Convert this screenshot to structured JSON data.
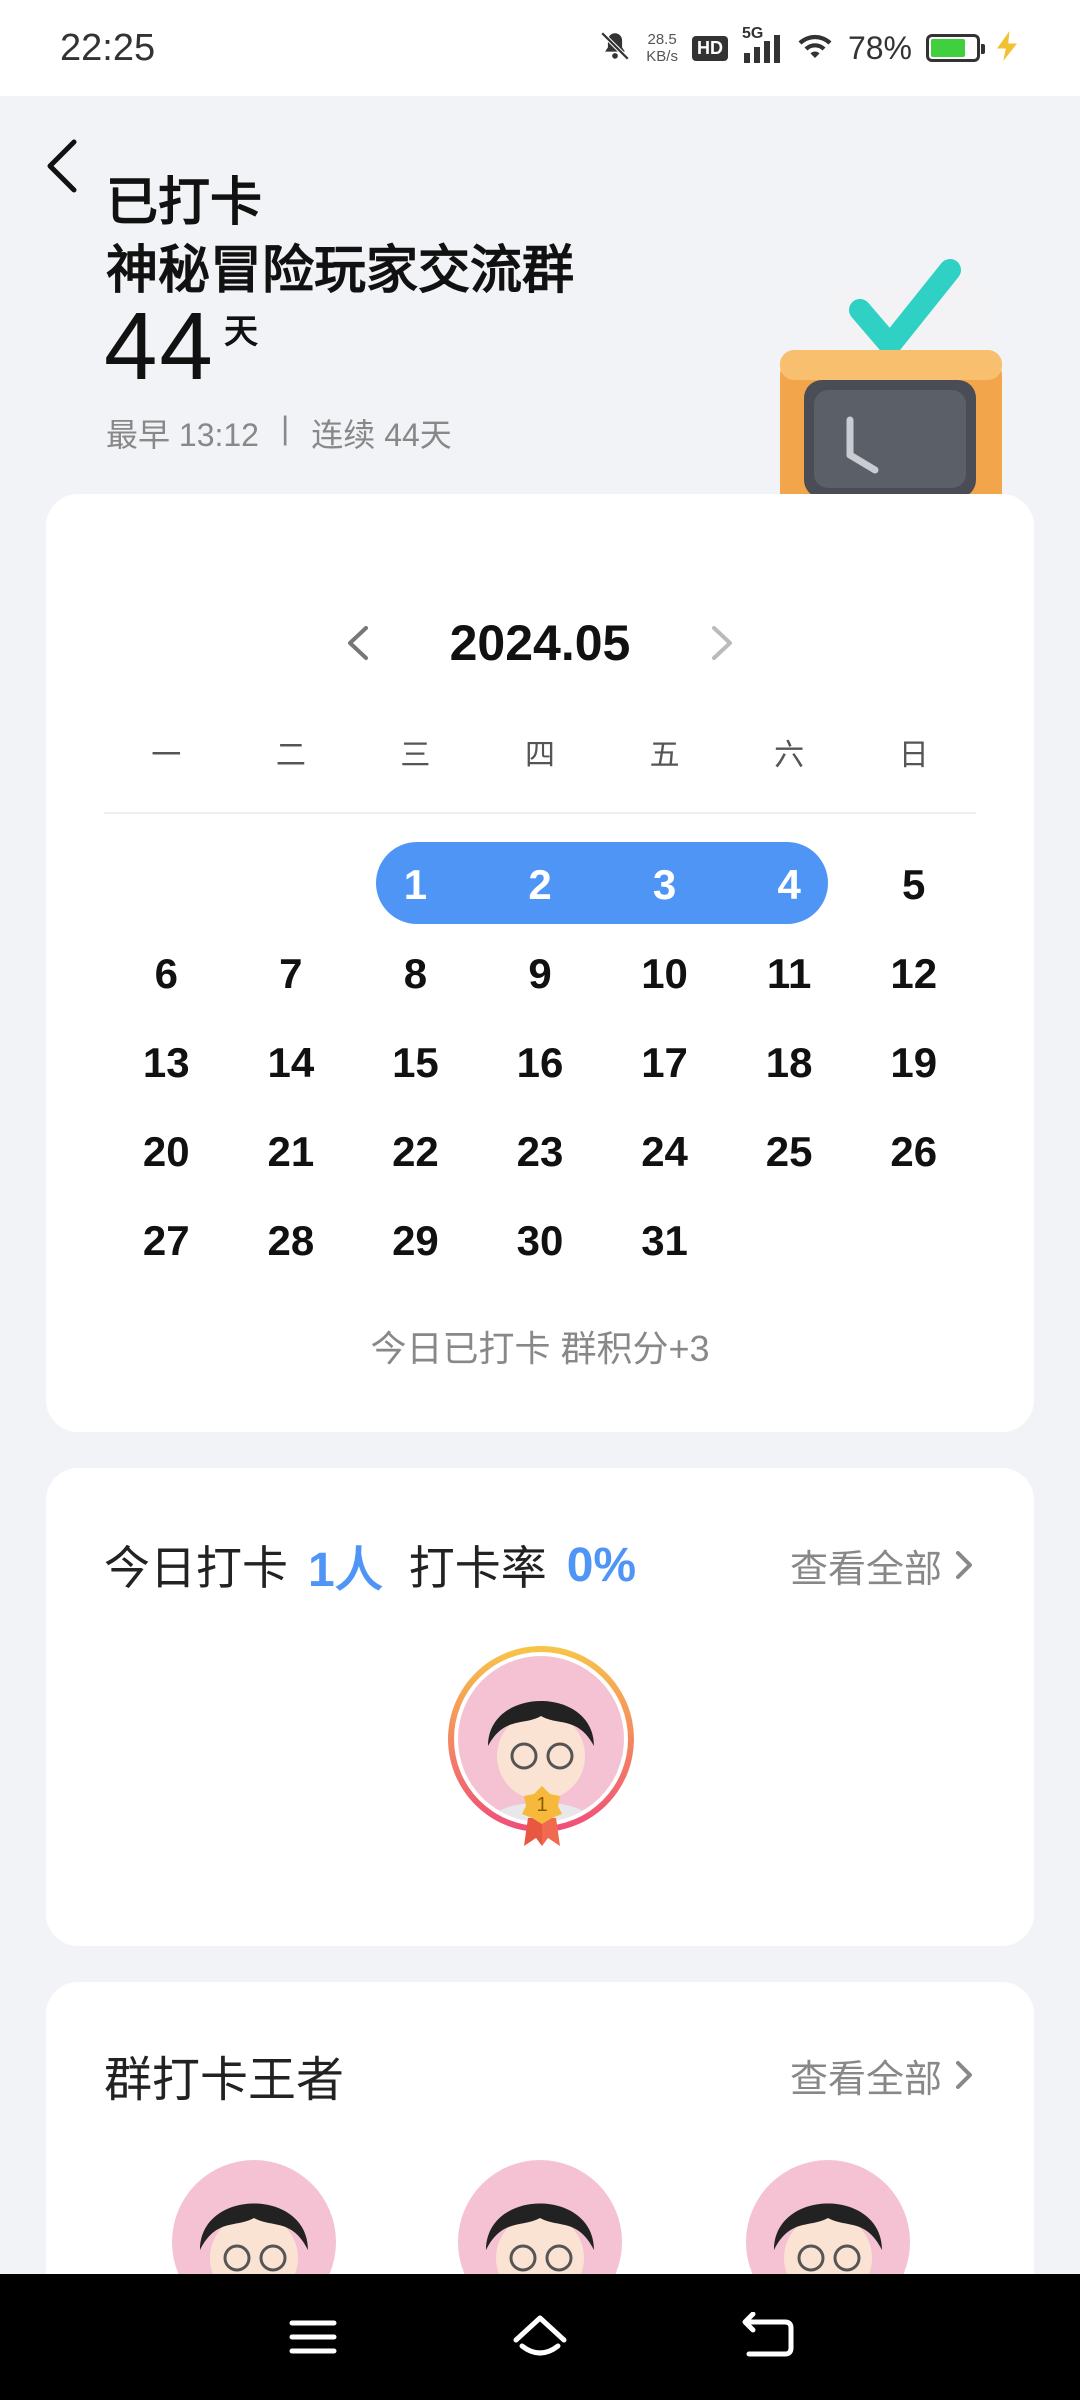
{
  "status_bar": {
    "time": "22:25",
    "speed_value": "28.5",
    "speed_unit": "KB/s",
    "hd": "HD",
    "network": "5G",
    "battery": "78%",
    "battery_level": 0.78
  },
  "header": {
    "status": "已打卡",
    "group_name": "神秘冒险玩家交流群",
    "days": "44",
    "days_unit": "天",
    "earliest": "最早 13:12",
    "separator": "|",
    "streak": "连续 44天"
  },
  "calendar": {
    "month": "2024.05",
    "weekdays": [
      "一",
      "二",
      "三",
      "四",
      "五",
      "六",
      "日"
    ],
    "leading_blanks": 2,
    "days": [
      "1",
      "2",
      "3",
      "4",
      "5",
      "6",
      "7",
      "8",
      "9",
      "10",
      "11",
      "12",
      "13",
      "14",
      "15",
      "16",
      "17",
      "18",
      "19",
      "20",
      "21",
      "22",
      "23",
      "24",
      "25",
      "26",
      "27",
      "28",
      "29",
      "30",
      "31"
    ],
    "checked_days": [
      1,
      2,
      3,
      4
    ],
    "footer": "今日已打卡   群积分+3"
  },
  "today": {
    "label": "今日打卡",
    "count": "1人",
    "rate_label": "打卡率",
    "rate": "0%",
    "see_all": "查看全部",
    "medal_rank": "1"
  },
  "king": {
    "title": "群打卡王者",
    "see_all": "查看全部"
  },
  "colors": {
    "accent": "#4f95f6",
    "background": "#f2f3f7"
  }
}
